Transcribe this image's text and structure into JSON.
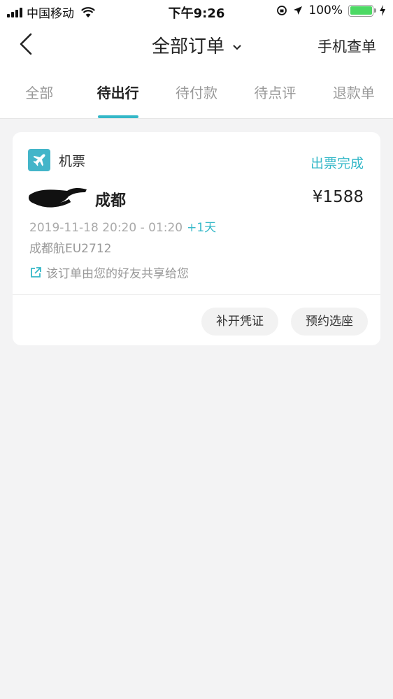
{
  "status_bar": {
    "carrier": "中国移动",
    "time": "下午9:26",
    "battery": "100%",
    "battery_level": 1.0
  },
  "navbar": {
    "title": "全部订单",
    "right_label": "手机查单",
    "icons": [
      "back-icon",
      "chevron-down-icon"
    ]
  },
  "tabs": [
    {
      "label": "全部",
      "active": false
    },
    {
      "label": "待出行",
      "active": true
    },
    {
      "label": "待付款",
      "active": false
    },
    {
      "label": "待点评",
      "active": false
    },
    {
      "label": "退款单",
      "active": false
    }
  ],
  "order": {
    "type": "机票",
    "status": "出票完成",
    "destination": "成都",
    "price": "¥1588",
    "time": "2019-11-18 20:20 - 01:20",
    "next_day": "+1天",
    "flight": "成都航EU2712",
    "share_note": "该订单由您的好友共享给您",
    "buttons": {
      "voucher": "补开凭证",
      "seat": "预约选座"
    }
  },
  "colors": {
    "accent": "#35b8c8",
    "plane_icon_bg": "#43b5c9",
    "page_bg": "#f3f3f4",
    "battery": "#4cd964"
  }
}
